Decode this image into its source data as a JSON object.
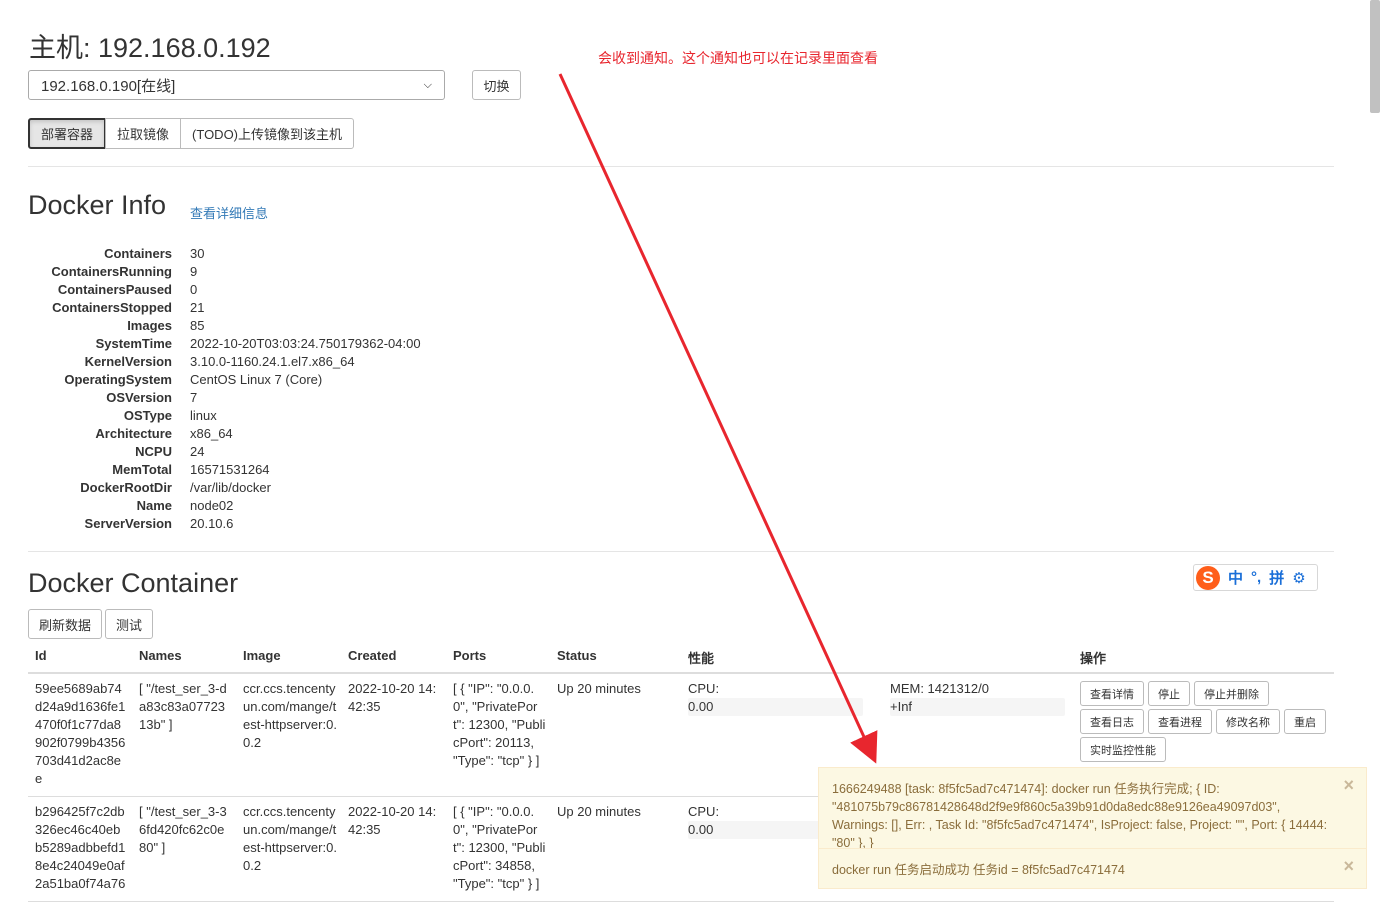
{
  "host": {
    "title": "主机: 192.168.0.192",
    "selected_option": "192.168.0.190[在线]",
    "switch_label": "切换"
  },
  "action_tabs": [
    {
      "label": "部署容器",
      "active": true
    },
    {
      "label": "拉取镜像",
      "active": false
    },
    {
      "label": "(TODO)上传镜像到该主机",
      "active": false
    }
  ],
  "docker_info": {
    "title": "Docker Info",
    "detail_link": "查看详细信息",
    "rows": [
      {
        "key": "Containers",
        "value": "30"
      },
      {
        "key": "ContainersRunning",
        "value": "9"
      },
      {
        "key": "ContainersPaused",
        "value": "0"
      },
      {
        "key": "ContainersStopped",
        "value": "21"
      },
      {
        "key": "Images",
        "value": "85"
      },
      {
        "key": "SystemTime",
        "value": "2022-10-20T03:03:24.750179362-04:00"
      },
      {
        "key": "KernelVersion",
        "value": "3.10.0-1160.24.1.el7.x86_64"
      },
      {
        "key": "OperatingSystem",
        "value": "CentOS Linux 7 (Core)"
      },
      {
        "key": "OSVersion",
        "value": "7"
      },
      {
        "key": "OSType",
        "value": "linux"
      },
      {
        "key": "Architecture",
        "value": "x86_64"
      },
      {
        "key": "NCPU",
        "value": "24"
      },
      {
        "key": "MemTotal",
        "value": "16571531264"
      },
      {
        "key": "DockerRootDir",
        "value": "/var/lib/docker"
      },
      {
        "key": "Name",
        "value": "node02"
      },
      {
        "key": "ServerVersion",
        "value": "20.10.6"
      }
    ]
  },
  "docker_container": {
    "title": "Docker Container",
    "refresh_label": "刷新数据",
    "test_label": "测试",
    "columns": {
      "id": "Id",
      "names": "Names",
      "image": "Image",
      "created": "Created",
      "ports": "Ports",
      "status": "Status",
      "perf": "性能",
      "ops": "操作"
    },
    "rows": [
      {
        "id": "59ee5689ab74d24a9d1636fe1470f0f1c77da8902f0799b4356703d41d2ac8ee",
        "names": "[ \"/test_ser_3-da83c83a0772313b\" ]",
        "image": "ccr.ccs.tencentyun.com/mange/test-httpserver:0.0.2",
        "created": "2022-10-20 14:42:35",
        "ports": "[ { \"IP\": \"0.0.0.0\", \"PrivatePort\": 12300, \"PublicPort\": 20113, \"Type\": \"tcp\" } ]",
        "status": "Up 20 minutes",
        "cpu_label": "CPU:",
        "cpu_value": "0.00",
        "mem_label": "MEM: 1421312/0",
        "mem_value": "+Inf",
        "buttons": [
          "查看详情",
          "停止",
          "停止并删除",
          "查看日志",
          "查看进程",
          "修改名称",
          "重启",
          "实时监控性能"
        ]
      },
      {
        "id": "b296425f7c2db326ec46c40ebb5289adbbefd18e4c24049e0af2a51ba0f74a76",
        "names": "[ \"/test_ser_3-36fd420fc62c0e80\" ]",
        "image": "ccr.ccs.tencentyun.com/mange/test-httpserver:0.0.2",
        "created": "2022-10-20 14:42:35",
        "ports": "[ { \"IP\": \"0.0.0.0\", \"PrivatePort\": 12300, \"PublicPort\": 34858, \"Type\": \"tcp\" } ]",
        "status": "Up 20 minutes",
        "cpu_label": "CPU:",
        "cpu_value": "0.00"
      }
    ]
  },
  "ime": {
    "items": [
      "中",
      "°,",
      "拼",
      "⚙"
    ]
  },
  "annotation": "会收到通知。这个通知也可以在记录里面查看",
  "notifications": [
    {
      "text": "1666249488 [task: 8f5fc5ad7c471474]: docker run 任务执行完成; { ID: \"481075b79c86781428648d2f9e9f860c5a39b91d0da8edc88e9126ea49097d03\", Warnings: [], Err: , Task Id: \"8f5fc5ad7c471474\", IsProject: false, Project: \"\", Port: { 14444: \"80\" }, }"
    },
    {
      "text": "docker run 任务启动成功 任务id = 8f5fc5ad7c471474"
    }
  ],
  "colors": {
    "annotation": "#e8262e",
    "link": "#337ab7",
    "toast_bg": "#fcf8e3",
    "toast_text": "#8a6d3b"
  }
}
